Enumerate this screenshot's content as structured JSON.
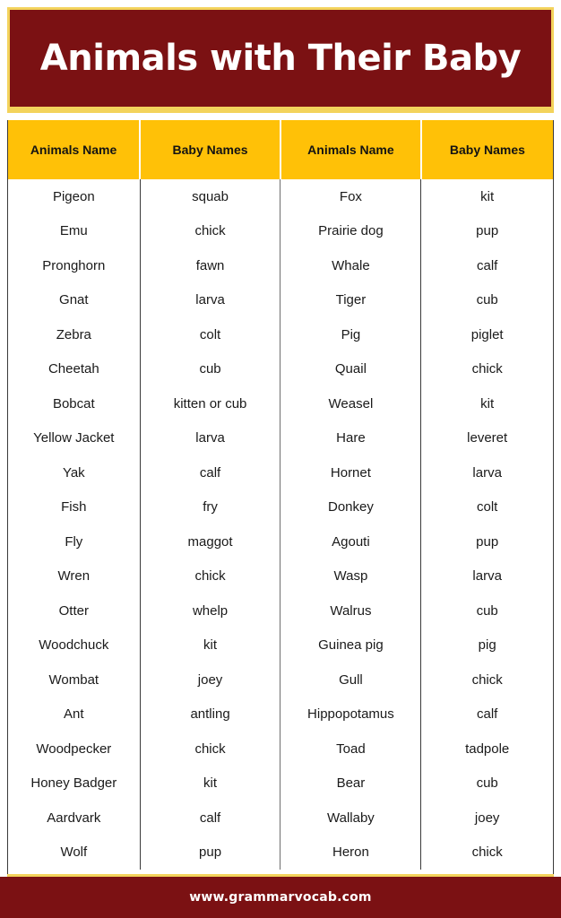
{
  "banner": {
    "title": "Animals with Their Baby",
    "background_color": "#7B1113",
    "border_color": "#F3D35C",
    "text_color": "#FFFFFF"
  },
  "table": {
    "header_background": "#FFC107",
    "headers": [
      "Animals Name",
      "Baby Names",
      "Animals Name",
      "Baby Names"
    ],
    "rows": [
      [
        "Pigeon",
        "squab",
        "Fox",
        "kit"
      ],
      [
        "Emu",
        "chick",
        "Prairie dog",
        "pup"
      ],
      [
        "Pronghorn",
        "fawn",
        "Whale",
        "calf"
      ],
      [
        "Gnat",
        "larva",
        "Tiger",
        "cub"
      ],
      [
        "Zebra",
        "colt",
        "Pig",
        "piglet"
      ],
      [
        "Cheetah",
        "cub",
        "Quail",
        "chick"
      ],
      [
        "Bobcat",
        "kitten or cub",
        "Weasel",
        "kit"
      ],
      [
        "Yellow Jacket",
        "larva",
        "Hare",
        "leveret"
      ],
      [
        "Yak",
        "calf",
        "Hornet",
        "larva"
      ],
      [
        "Fish",
        "fry",
        "Donkey",
        "colt"
      ],
      [
        "Fly",
        "maggot",
        "Agouti",
        "pup"
      ],
      [
        "Wren",
        "chick",
        "Wasp",
        "larva"
      ],
      [
        "Otter",
        "whelp",
        "Walrus",
        "cub"
      ],
      [
        "Woodchuck",
        "kit",
        "Guinea pig",
        "pig"
      ],
      [
        "Wombat",
        "joey",
        "Gull",
        "chick"
      ],
      [
        "Ant",
        "antling",
        "Hippopotamus",
        "calf"
      ],
      [
        "Woodpecker",
        "chick",
        "Toad",
        "tadpole"
      ],
      [
        "Honey Badger",
        "kit",
        "Bear",
        "cub"
      ],
      [
        "Aardvark",
        "calf",
        "Wallaby",
        "joey"
      ],
      [
        "Wolf",
        "pup",
        "Heron",
        "chick"
      ]
    ]
  },
  "footer": {
    "website": "www.grammarvocab.com",
    "background_color": "#7B1113",
    "text_color": "#FFFFFF"
  }
}
